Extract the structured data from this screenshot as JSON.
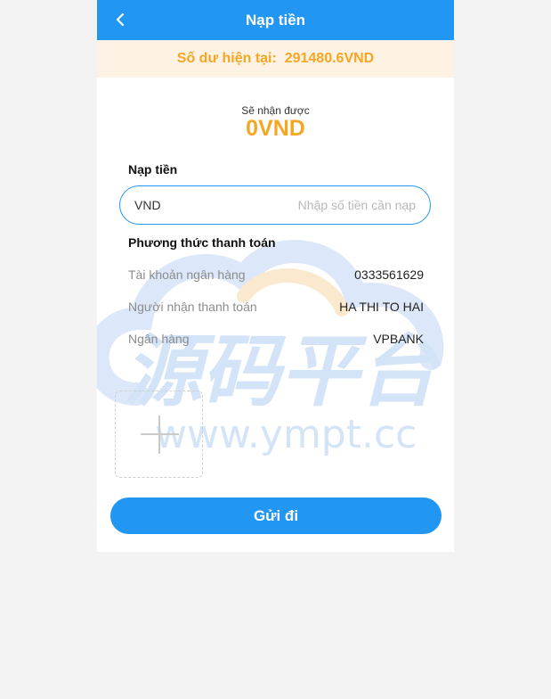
{
  "header": {
    "title": "Nạp tiền",
    "back_icon": "chevron-left-icon"
  },
  "balance": {
    "label": "Số dư hiện tại:",
    "value": "291480.6VND"
  },
  "receive": {
    "label": "Sẽ nhận được",
    "amount": "0VND"
  },
  "deposit": {
    "section_title": "Nạp tiền",
    "currency": "VND",
    "input_value": "",
    "placeholder": "Nhập số tiền cần nạp"
  },
  "payment": {
    "section_title": "Phương thức thanh toán",
    "rows": [
      {
        "label": "Tài khoản ngân hàng",
        "value": "0333561629"
      },
      {
        "label": "Người nhận thanh toán",
        "value": "HA THI TO HAI"
      },
      {
        "label": "Ngân hàng",
        "value": "VPBANK"
      }
    ]
  },
  "upload": {
    "icon": "plus-icon"
  },
  "submit": {
    "label": "Gửi đi"
  },
  "watermark": {
    "cn_text": "源码平台",
    "url_text": "www.ympt.cc"
  },
  "colors": {
    "primary": "#2196f3",
    "accent": "#f5a623",
    "balance_bg": "#fdf2e3"
  }
}
